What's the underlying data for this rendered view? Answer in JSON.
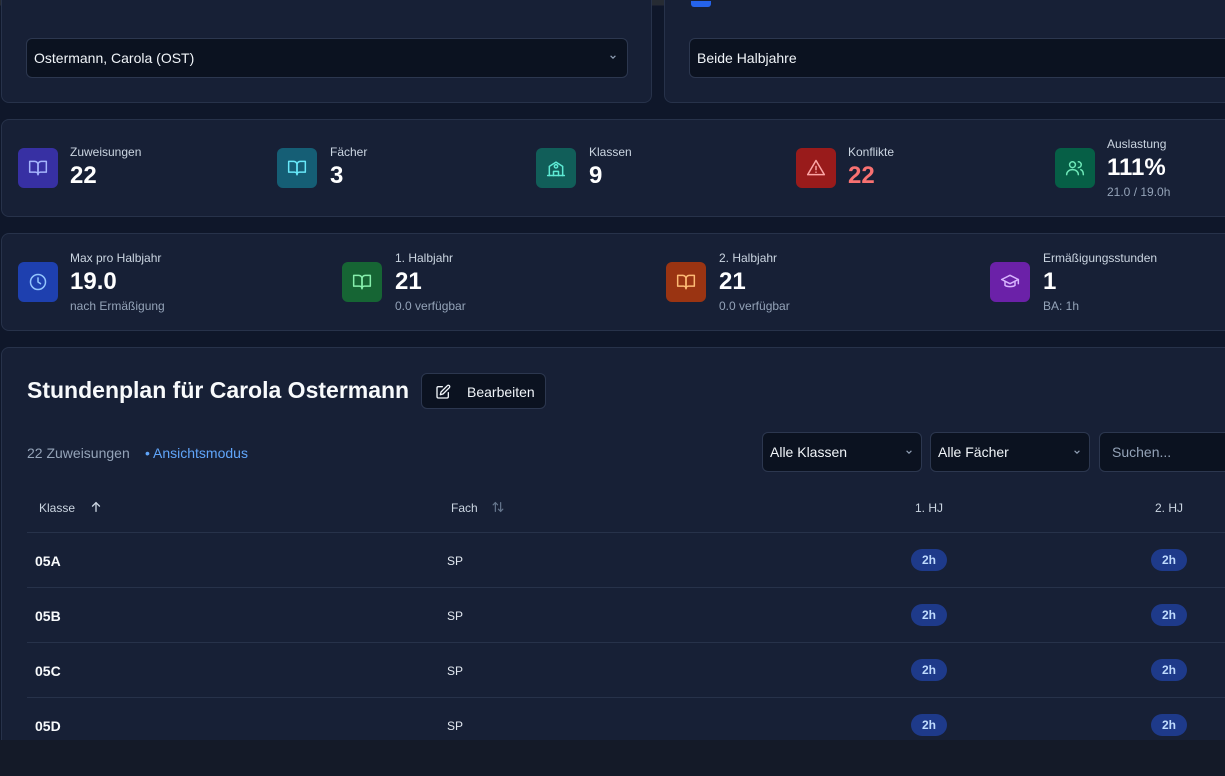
{
  "teacher_select": {
    "value": "Ostermann, Carola (OST)"
  },
  "term_select": {
    "value": "Beide Halbjahre"
  },
  "stats_row1": [
    {
      "label": "Zuweisungen",
      "value": "22",
      "sub": "",
      "icon": "book-open-icon",
      "color": "#3730a3"
    },
    {
      "label": "Fächer",
      "value": "3",
      "sub": "",
      "icon": "book-open-icon",
      "color": "#155e75"
    },
    {
      "label": "Klassen",
      "value": "9",
      "sub": "",
      "icon": "school-icon",
      "color": "#115e59"
    },
    {
      "label": "Konflikte",
      "value": "22",
      "sub": "",
      "icon": "alert-triangle-icon",
      "color": "#991b1b"
    },
    {
      "label": "Auslastung",
      "value": "111%",
      "sub": "21.0 / 19.0h",
      "icon": "users-icon",
      "color": "#065f46"
    }
  ],
  "stats_row2": [
    {
      "label": "Max pro Halbjahr",
      "value": "19.0",
      "sub": "nach Ermäßigung",
      "icon": "clock-icon",
      "color": "#1e40af"
    },
    {
      "label": "1. Halbjahr",
      "value": "21",
      "sub": "0.0 verfügbar",
      "icon": "book-open-icon",
      "color": "#166534"
    },
    {
      "label": "2. Halbjahr",
      "value": "21",
      "sub": "0.0 verfügbar",
      "icon": "book-open-icon",
      "color": "#9a3412"
    },
    {
      "label": "Ermäßigungsstunden",
      "value": "1",
      "sub": "BA: 1h",
      "icon": "graduation-cap-icon",
      "color": "#6b21a8"
    }
  ],
  "accent_colors": {
    "conflict_value": "#f87171",
    "mode": "#60a5fa",
    "pill_bg": "#1e3a8a"
  },
  "timetable": {
    "title": "Stundenplan für Carola Ostermann",
    "edit_label": "Bearbeiten",
    "count": "22 Zuweisungen",
    "mode": "• Ansichtsmodus",
    "filters": {
      "klassen": "Alle Klassen",
      "faecher": "Alle Fächer",
      "search_placeholder": "Suchen..."
    },
    "columns": {
      "klasse": "Klasse",
      "fach": "Fach",
      "hj1": "1. HJ",
      "hj2": "2. HJ"
    },
    "rows": [
      {
        "klasse": "05A",
        "fach": "SP",
        "hj1": "2h",
        "hj2": "2h"
      },
      {
        "klasse": "05B",
        "fach": "SP",
        "hj1": "2h",
        "hj2": "2h"
      },
      {
        "klasse": "05C",
        "fach": "SP",
        "hj1": "2h",
        "hj2": "2h"
      },
      {
        "klasse": "05D",
        "fach": "SP",
        "hj1": "2h",
        "hj2": "2h"
      }
    ]
  }
}
